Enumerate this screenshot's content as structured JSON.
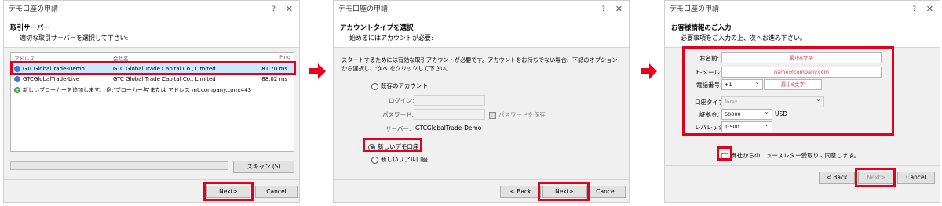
{
  "colors": {
    "highlight_red": "#e3001b",
    "arrow_red": "#e8001c",
    "selected_row": "#cce8ff"
  },
  "dialog1": {
    "title": "デモ口座の申請",
    "help": "?",
    "close": "✕",
    "header_title": "取引サーバー",
    "header_sub": "適切な取引サーバーを選択して下さい:",
    "columns": {
      "address": "アドレス",
      "company": "会社名",
      "ping": "Ping"
    },
    "rows": [
      {
        "address": "GTCGlobalTrade-Demo",
        "company": "GTC Global Trade Capital Co., Limited",
        "ping": "81.70 ms"
      },
      {
        "address": "GTCGlobalTrade-Live",
        "company": "GTC Global Trade Capital Co., Limited",
        "ping": "88.02 ms"
      }
    ],
    "add_broker": "新しいブローカーを追加します。 例:'ブローカー名'または アドレス mt.company.com:443",
    "scan": "スキャン (S)",
    "next": "Next>",
    "cancel": "Cancel"
  },
  "dialog2": {
    "title": "デモ口座の申請",
    "help": "?",
    "close": "✕",
    "header_title": "アカウントタイプを選択",
    "header_sub": "始めるにはアカウントが必要:",
    "intro": "スタートするためには有効な取引アカウントが必要です。アカウントをお持ちでない場合、下記のオプションから選択し、'次へ'をクリックして下さい。",
    "existing": "既存のアカウント",
    "login_label": "ログイン:",
    "password_label": "パスワード:",
    "save_password": "パスワードを保存",
    "server_label": "サーバー:",
    "server_value": "GTCGlobalTrade-Demo",
    "new_demo": "新しいデモ口座",
    "new_real": "新しいリアル口座",
    "back": "< Back",
    "next": "Next>",
    "cancel": "Cancel"
  },
  "dialog3": {
    "title": "デモ口座の申請",
    "help": "?",
    "close": "✕",
    "header_title": "お客様情報のご入力",
    "header_sub": "必要事項をご入力の上、次へお進み下さい。",
    "name_label": "お名前:",
    "name_placeholder": "最小6文字",
    "email_label": "E-メール:",
    "email_placeholder": "name@company.com",
    "phone_label": "電話番号:",
    "phone_code": "+1",
    "phone_placeholder": "最小6文字",
    "account_type_label": "口座タイプ:",
    "account_type_value": "forex",
    "deposit_label": "証拠金:",
    "deposit_value": "50000",
    "deposit_currency": "USD",
    "leverage_label": "レバレッジ:",
    "leverage_value": "1:500",
    "newsletter": "貴社からのニュースレター受取りに同意します。",
    "back": "< Back",
    "next": "Next>",
    "cancel": "Cancel"
  }
}
